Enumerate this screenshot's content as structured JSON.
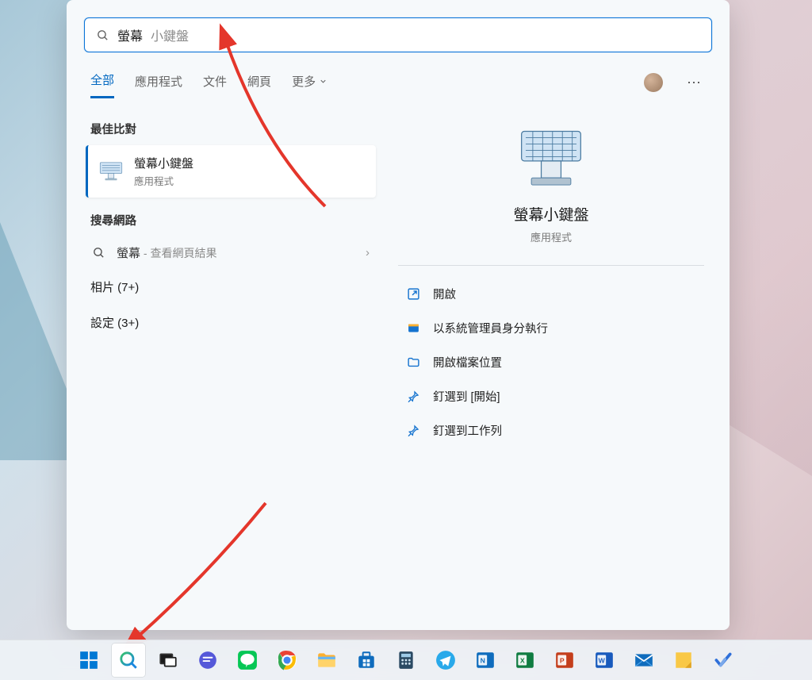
{
  "search": {
    "typed": "螢幕",
    "suggestion": "小鍵盤"
  },
  "tabs": {
    "all": "全部",
    "apps": "應用程式",
    "documents": "文件",
    "web": "網頁",
    "more": "更多"
  },
  "left": {
    "best_match_label": "最佳比對",
    "best_match": {
      "title": "螢幕小鍵盤",
      "subtitle": "應用程式"
    },
    "search_web_label": "搜尋網路",
    "web_item": {
      "term": "螢幕",
      "hint": " - 查看網頁結果"
    },
    "photos_line": "相片 (7+)",
    "settings_line": "設定 (3+)"
  },
  "preview": {
    "title": "螢幕小鍵盤",
    "subtitle": "應用程式",
    "actions": {
      "open": "開啟",
      "run_admin": "以系統管理員身分執行",
      "open_location": "開啟檔案位置",
      "pin_start": "釘選到 [開始]",
      "pin_taskbar": "釘選到工作列"
    }
  },
  "taskbar": {
    "items": [
      "start",
      "search",
      "task-view",
      "chat",
      "line",
      "chrome",
      "explorer",
      "store",
      "calculator",
      "telegram",
      "onenote",
      "excel",
      "powerpoint",
      "word",
      "mail",
      "sticky-notes",
      "todo"
    ]
  }
}
